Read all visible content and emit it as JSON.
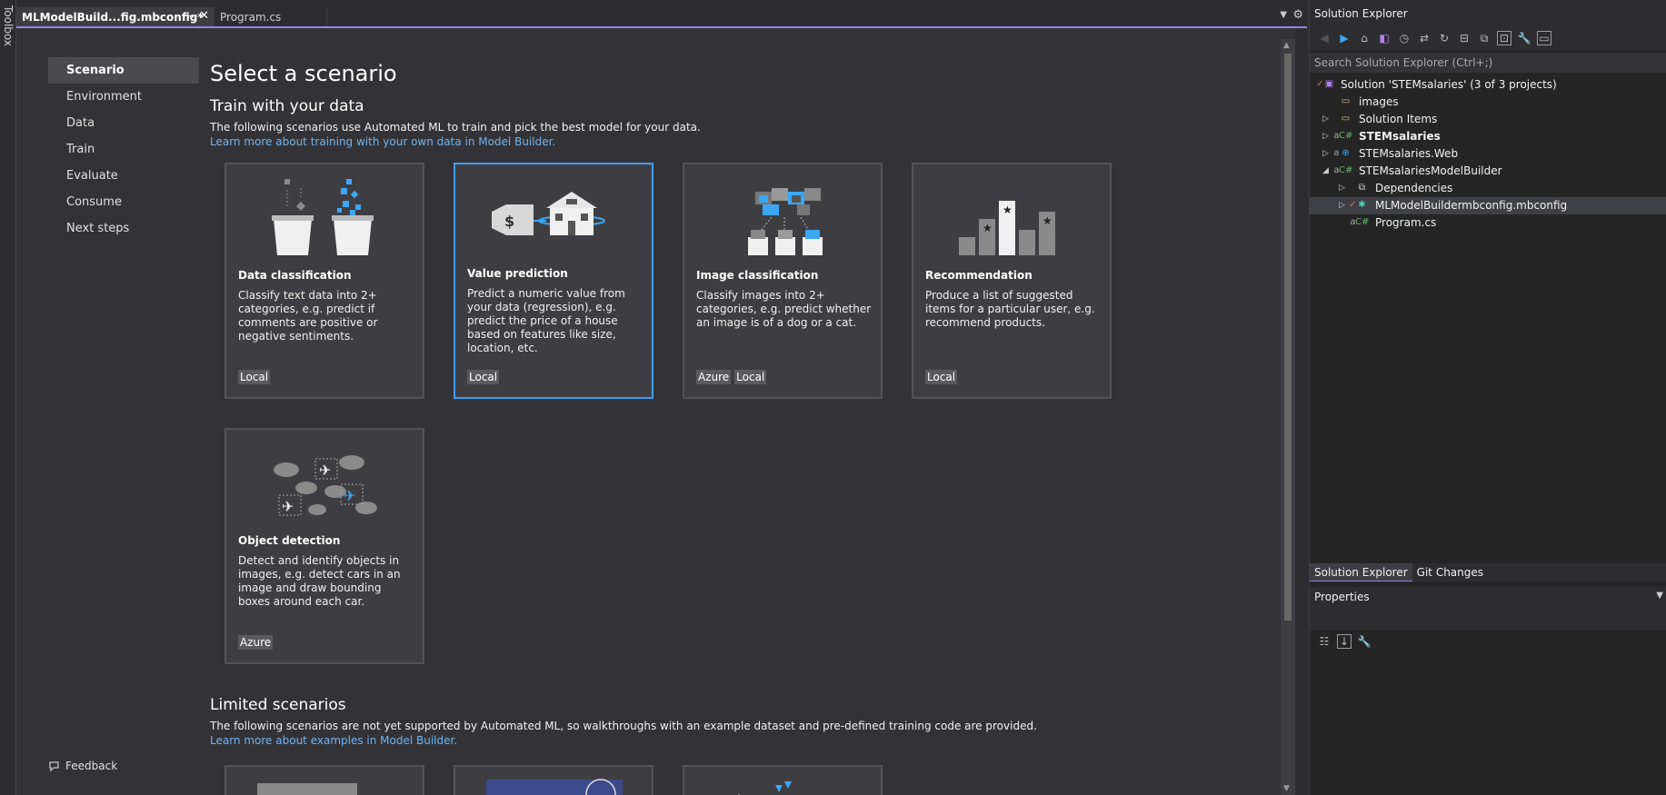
{
  "toolbox": {
    "label": "Toolbox"
  },
  "tabs": [
    {
      "label": "MLModelBuild...fig.mbconfig*",
      "active": true
    },
    {
      "label": "Program.cs",
      "active": false
    }
  ],
  "nav": {
    "items": [
      "Scenario",
      "Environment",
      "Data",
      "Train",
      "Evaluate",
      "Consume",
      "Next steps"
    ],
    "active": "Scenario",
    "feedback": "Feedback"
  },
  "content": {
    "title": "Select a scenario",
    "train_heading": "Train with your data",
    "train_desc": "The following scenarios use Automated ML to train and pick the best model for your data.",
    "train_link": "Learn more about training with your own data in Model Builder.",
    "cards": [
      {
        "title": "Data classification",
        "desc": "Classify text data into 2+ categories, e.g. predict if comments are positive or negative sentiments.",
        "tags": [
          "Local"
        ]
      },
      {
        "title": "Value prediction",
        "desc": "Predict a numeric value from your data (regression), e.g. predict the price of a house based on features like size, location, etc.",
        "tags": [
          "Local"
        ]
      },
      {
        "title": "Image classification",
        "desc": "Classify images into 2+ categories, e.g. predict whether an image is of a dog or a cat.",
        "tags": [
          "Azure",
          "Local"
        ]
      },
      {
        "title": "Recommendation",
        "desc": "Produce a list of suggested items for a particular user, e.g. recommend products.",
        "tags": [
          "Local"
        ]
      },
      {
        "title": "Object detection",
        "desc": "Detect and identify objects in images, e.g. detect cars in an image and draw bounding boxes around each car.",
        "tags": [
          "Azure"
        ]
      }
    ],
    "limited_heading": "Limited scenarios",
    "limited_desc": "The following scenarios are not yet supported by Automated ML, so walkthroughs with an example dataset and pre-defined training code are provided.",
    "limited_link": "Learn more about examples in Model Builder."
  },
  "solution_explorer": {
    "title": "Solution Explorer",
    "search_placeholder": "Search Solution Explorer (Ctrl+;)",
    "tree": [
      {
        "label": "Solution 'STEMsalaries' (3 of 3 projects)"
      },
      {
        "label": "images"
      },
      {
        "label": "Solution Items"
      },
      {
        "label": "STEMsalaries"
      },
      {
        "label": "STEMsalaries.Web"
      },
      {
        "label": "STEMsalariesModelBuilder"
      },
      {
        "label": "Dependencies"
      },
      {
        "label": "MLModelBuildermbconfig.mbconfig"
      },
      {
        "label": "Program.cs"
      }
    ],
    "bottom_tabs": [
      "Solution Explorer",
      "Git Changes"
    ],
    "properties_title": "Properties"
  },
  "colors": {
    "accent": "#9184ee",
    "link": "#6fb3f0",
    "selected_border": "#3e9ff5",
    "highlight_blue": "#3ba7f5"
  }
}
